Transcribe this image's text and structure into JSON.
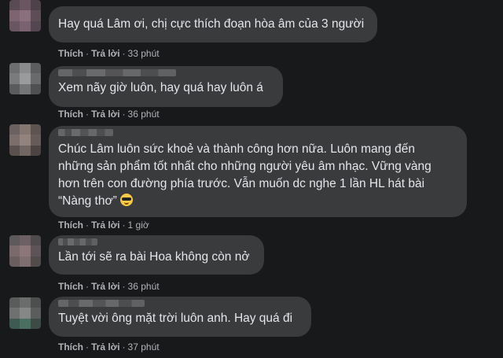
{
  "comments": [
    {
      "text": "Hay quá Lâm ơi, chị cực thích đoạn hòa âm của 3 người",
      "like": "Thích",
      "reply": "Trả lời",
      "time": "33 phút"
    },
    {
      "text": "Xem nãy giờ luôn, hay quá hay luôn á",
      "like": "Thích",
      "reply": "Trả lời",
      "time": "36 phút"
    },
    {
      "text": "Chúc Lâm luôn sức khoẻ và thành công hơn nữa. Luôn mang đến\nnhững sản phẩm tốt nhất cho những người yêu âm nhạc. Vững vàng\nhơn trên con đường phía trước. Vẫn muốn dc nghe 1 lần HL hát bài\n“Nàng thơ”",
      "emoji": "smiling-face-with-sunglasses",
      "like": "Thích",
      "reply": "Trả lời",
      "time": "1 giờ"
    },
    {
      "text": "Lần tới sẽ ra bài Hoa không còn nở",
      "like": "Thích",
      "reply": "Trả lời",
      "time": "36 phút"
    },
    {
      "text": "Tuyệt vời ông mặt trời luôn anh. Hay quá đi",
      "like": "Thích",
      "reply": "Trả lời",
      "time": "37 phút"
    }
  ],
  "colors": {
    "background": "#18191a",
    "bubble": "#3a3b3c",
    "text": "#e4e6eb",
    "secondary_text": "#b0b3b8"
  }
}
